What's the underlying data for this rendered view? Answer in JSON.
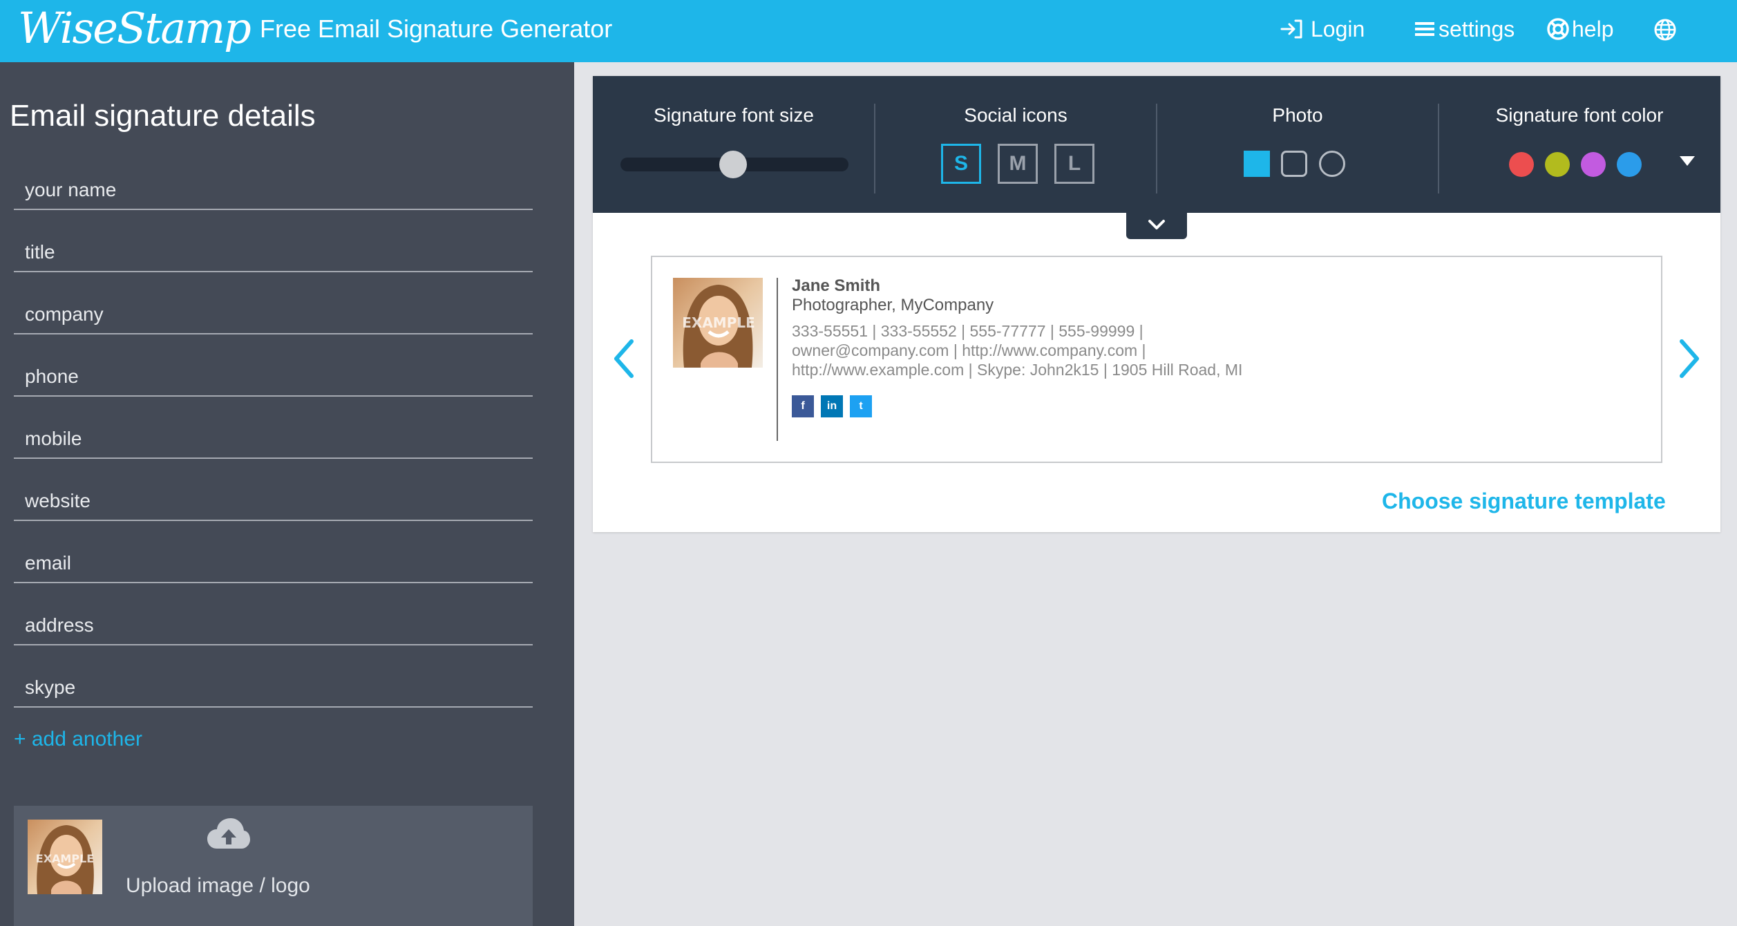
{
  "header": {
    "logo": "WiseStamp",
    "app_title": "Free Email Signature Generator",
    "nav": {
      "login": "Login",
      "settings": "settings",
      "help": "help",
      "language_icon": "globe-icon"
    }
  },
  "sidebar": {
    "title": "Email signature details",
    "fields": [
      {
        "placeholder": "your name",
        "value": ""
      },
      {
        "placeholder": "title",
        "value": ""
      },
      {
        "placeholder": "company",
        "value": ""
      },
      {
        "placeholder": "phone",
        "value": ""
      },
      {
        "placeholder": "mobile",
        "value": ""
      },
      {
        "placeholder": "website",
        "value": ""
      },
      {
        "placeholder": "email",
        "value": ""
      },
      {
        "placeholder": "address",
        "value": ""
      },
      {
        "placeholder": "skype",
        "value": ""
      }
    ],
    "add_another": "+ add another",
    "upload": {
      "label": "Upload image / logo",
      "thumb_watermark": "EXAMPLE",
      "icon": "cloud-upload-icon"
    }
  },
  "toolbar": {
    "font_size": {
      "label": "Signature font size",
      "level": 0.5
    },
    "social_icons": {
      "label": "Social icons",
      "options": [
        "S",
        "M",
        "L"
      ],
      "selected": "S"
    },
    "photo": {
      "label": "Photo",
      "options": [
        "square-filled",
        "rounded-square",
        "circle"
      ],
      "selected": "square-filled"
    },
    "font_color": {
      "label": "Signature font color",
      "colors": [
        "#ec4e4f",
        "#b2bb1e",
        "#c25be0",
        "#2b9cea"
      ]
    }
  },
  "preview": {
    "photo_watermark": "EXAMPLE",
    "name": "Jane Smith",
    "title": "Photographer, MyCompany",
    "line1": "333-55551 | 333-55552 | 555-77777 | 555-99999 |",
    "line2": "owner@company.com | http://www.company.com |",
    "line3": "http://www.example.com | Skype: John2k15 | 1905 Hill Road, MI",
    "social": [
      {
        "label": "f",
        "color": "#3b5998",
        "icon": "facebook-icon"
      },
      {
        "label": "in",
        "color": "#0077b5",
        "icon": "linkedin-icon"
      },
      {
        "label": "t",
        "color": "#1da1f2",
        "icon": "twitter-icon"
      }
    ]
  },
  "choose_template": "Choose signature template",
  "colors": {
    "accent": "#1eb6e9",
    "toolbar_bg": "#2b3848",
    "sidebar_bg": "#444a56",
    "page_bg": "#e3e4e8"
  }
}
